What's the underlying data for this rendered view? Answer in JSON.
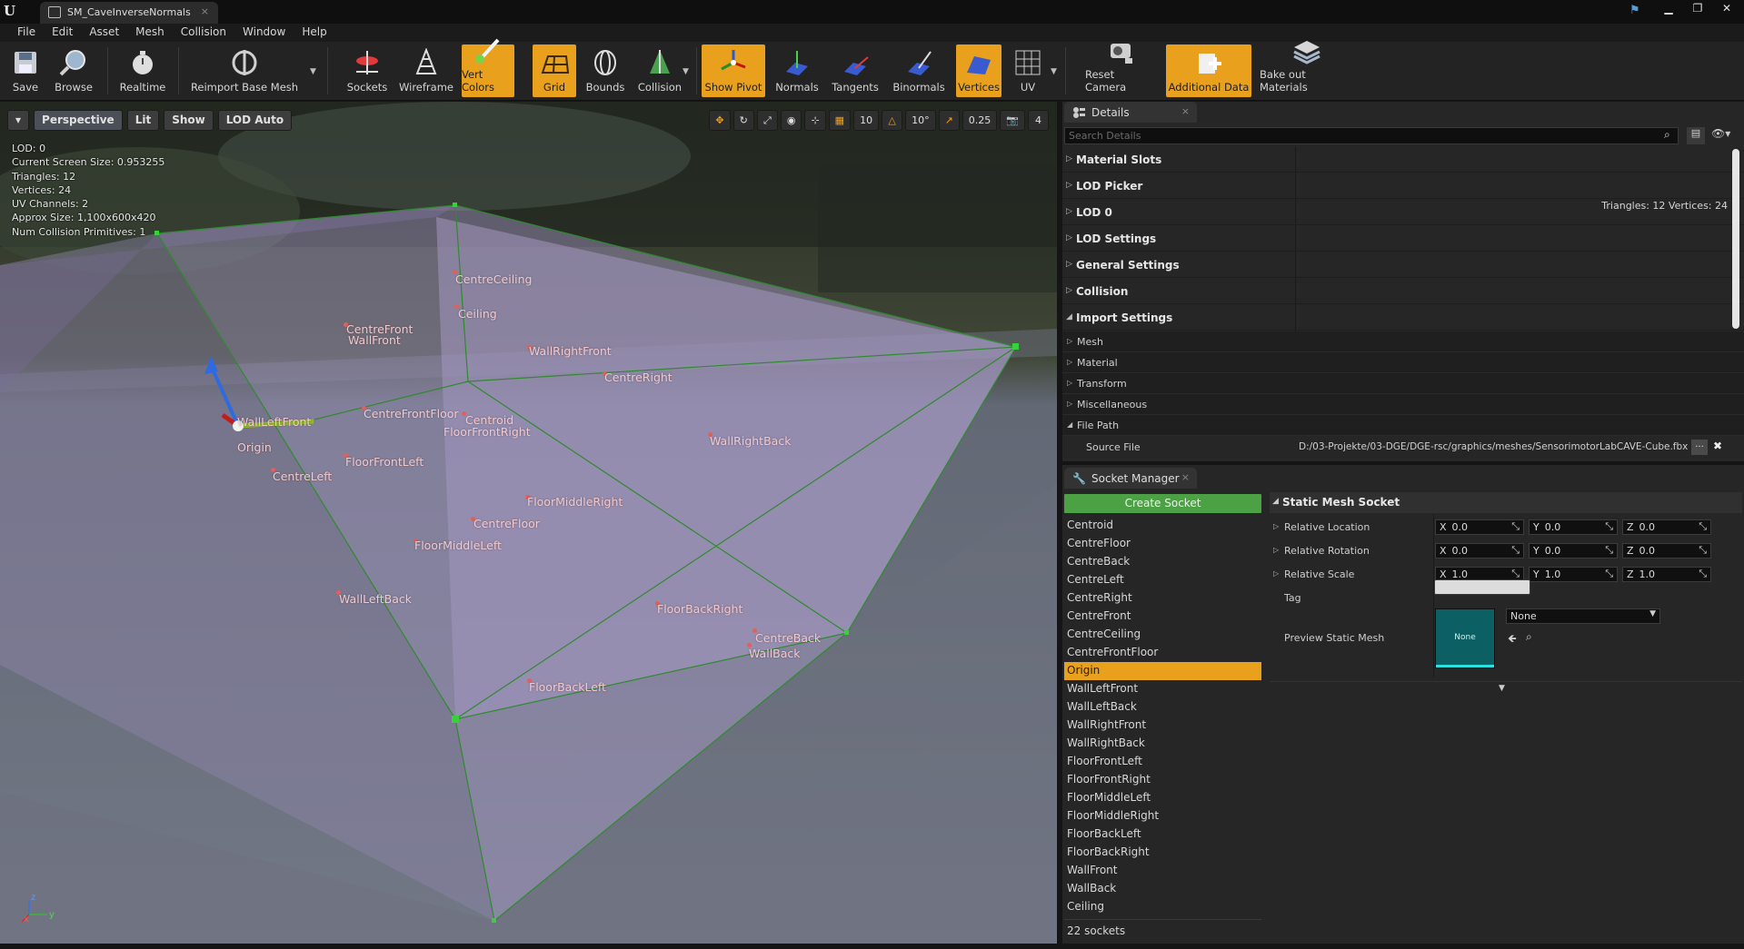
{
  "window": {
    "tab_title": "SM_CaveInverseNormals",
    "close_glyph": "×"
  },
  "menu": [
    "File",
    "Edit",
    "Asset",
    "Mesh",
    "Collision",
    "Window",
    "Help"
  ],
  "toolbar": {
    "save": "Save",
    "browse": "Browse",
    "realtime": "Realtime",
    "reimport": "Reimport Base Mesh",
    "sockets": "Sockets",
    "wireframe": "Wireframe",
    "vert_colors": "Vert Colors",
    "grid": "Grid",
    "bounds": "Bounds",
    "collision": "Collision",
    "show_pivot": "Show Pivot",
    "normals": "Normals",
    "tangents": "Tangents",
    "binormals": "Binormals",
    "vertices": "Vertices",
    "uv": "UV",
    "reset_camera": "Reset Camera",
    "additional_data": "Additional Data",
    "bake_out": "Bake out Materials",
    "active_color": "#e8a01d"
  },
  "viewport": {
    "perspective": "Perspective",
    "lit": "Lit",
    "show": "Show",
    "lod_auto": "LOD Auto",
    "snap_grid": "10",
    "snap_rot": "10°",
    "snap_scale": "0.25",
    "cam_speed": "4",
    "stats": [
      "LOD:  0",
      "Current Screen Size:  0.953255",
      "Triangles:  12",
      "Vertices:  24",
      "UV Channels:  2",
      "Approx Size: 1,100x600x420",
      "Num Collision Primitives:  1"
    ],
    "socket_labels": {
      "centre_ceiling": "CentreCeiling",
      "ceiling": "Ceiling",
      "centre_front": "CentreFront",
      "wall_front": "WallFront",
      "wall_right_front": "WallRightFront",
      "centre_right": "CentreRight",
      "wall_left_front": "WallLeftFront",
      "origin": "Origin",
      "centre_front_floor": "CentreFrontFloor",
      "centroid": "Centroid",
      "floor_front_right": "FloorFrontRight",
      "wall_right_back": "WallRightBack",
      "centre_left": "CentreLeft",
      "floor_front_left": "FloorFrontLeft",
      "floor_middle_right": "FloorMiddleRight",
      "centre_floor": "CentreFloor",
      "floor_middle_left": "FloorMiddleLeft",
      "wall_left_back": "WallLeftBack",
      "floor_back_right": "FloorBackRight",
      "centre_back": "CentreBack",
      "wall_back": "WallBack",
      "floor_back_left": "FloorBackLeft"
    },
    "axis": {
      "z": "z",
      "x": "x",
      "y": "y"
    }
  },
  "details": {
    "tab": "Details",
    "search_placeholder": "Search Details",
    "sections": [
      "Material Slots",
      "LOD Picker",
      "LOD 0",
      "LOD Settings",
      "General Settings",
      "Collision",
      "Import Settings"
    ],
    "import_subs": [
      "Mesh",
      "Material",
      "Transform",
      "Miscellaneous",
      "File Path"
    ],
    "source_file_label": "Source File",
    "source_file_value": "D:/03-Projekte/03-DGE/DGE-rsc/graphics/meshes/SensorimotorLabCAVE-Cube.fbx",
    "tri_vert": "Triangles: 12    Vertices: 24",
    "browse_dots": "...",
    "clear_x": "✖"
  },
  "socket_manager": {
    "tab": "Socket Manager",
    "create": "Create Socket",
    "sockets": [
      "Centroid",
      "CentreFloor",
      "CentreBack",
      "CentreLeft",
      "CentreRight",
      "CentreFront",
      "CentreCeiling",
      "CentreFrontFloor",
      "Origin",
      "WallLeftFront",
      "WallLeftBack",
      "WallRightFront",
      "WallRightBack",
      "FloorFrontLeft",
      "FloorFrontRight",
      "FloorMiddleLeft",
      "FloorMiddleRight",
      "FloorBackLeft",
      "FloorBackRight",
      "WallFront",
      "WallBack",
      "Ceiling"
    ],
    "selected": "Origin",
    "count": "22 sockets",
    "section": "Static Mesh Socket",
    "relative_location": "Relative Location",
    "relative_rotation": "Relative Rotation",
    "relative_scale": "Relative Scale",
    "tag": "Tag",
    "preview_static_mesh": "Preview Static Mesh",
    "location": {
      "x": "0.0",
      "y": "0.0",
      "z": "0.0"
    },
    "rotation": {
      "x": "0.0",
      "y": "0.0",
      "z": "0.0"
    },
    "scale": {
      "x": "1.0",
      "y": "1.0",
      "z": "1.0"
    },
    "axis_x": "X",
    "axis_y": "Y",
    "axis_z": "Z",
    "preview_none_thumb": "None",
    "preview_none_combo": "None"
  }
}
